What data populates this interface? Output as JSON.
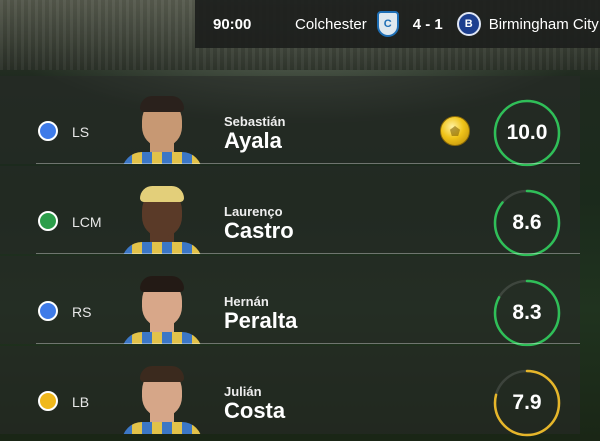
{
  "scorebar": {
    "time": "90:00",
    "home_team": "Colchester",
    "score": "4 - 1",
    "away_team": "Birmingham City",
    "home_crest": "colchester-crest-icon",
    "away_crest": "birmingham-crest-icon"
  },
  "players": [
    {
      "position": "LS",
      "position_color": "#3f7be8",
      "first_name": "Sebastián",
      "last_name": "Ayala",
      "rating": "10.0",
      "rating_fraction": 1.0,
      "ring_color": "#2fbf58",
      "man_of_match": true,
      "badge_icon": "golden-ball-icon"
    },
    {
      "position": "LCM",
      "position_color": "#2c9e4b",
      "first_name": "Laurenço",
      "last_name": "Castro",
      "rating": "8.6",
      "rating_fraction": 0.86,
      "ring_color": "#2fbf58",
      "man_of_match": false
    },
    {
      "position": "RS",
      "position_color": "#3f7be8",
      "first_name": "Hernán",
      "last_name": "Peralta",
      "rating": "8.3",
      "rating_fraction": 0.83,
      "ring_color": "#2fbf58",
      "man_of_match": false
    },
    {
      "position": "LB",
      "position_color": "#f0b81c",
      "first_name": "Julián",
      "last_name": "Costa",
      "rating": "7.9",
      "rating_fraction": 0.79,
      "ring_color": "#e6b62a",
      "man_of_match": false
    }
  ],
  "skin_tones": [
    "#c79873",
    "#5a3a28",
    "#d8a789",
    "#d6a688"
  ],
  "hair_colors": [
    "#2a211c",
    "#e3cf7a",
    "#231a15",
    "#3b2a1e"
  ]
}
